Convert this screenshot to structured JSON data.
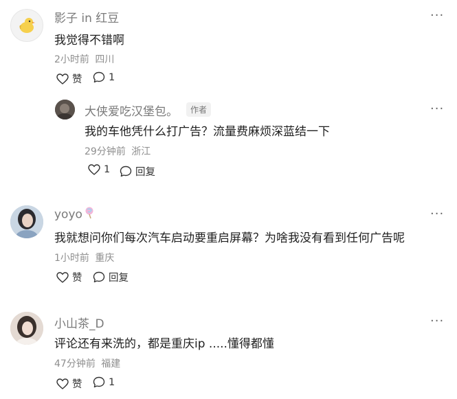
{
  "comments": [
    {
      "author": "影子 in 红豆",
      "text": "我觉得不错啊",
      "time": "2小时前",
      "location": "四川",
      "like_label": "赞",
      "reply_count": "1",
      "more": "···"
    },
    {
      "author": "大侠爱吃汉堡包。",
      "author_tag": "作者",
      "text": "我的车他凭什么打广告？流量费麻烦深蓝结一下",
      "time": "29分钟前",
      "location": "浙江",
      "like_count": "1",
      "reply_label": "回复",
      "more": "···"
    },
    {
      "author": "yoyo",
      "text": "我就想问你们每次汽车启动要重启屏幕？为啥我没有看到任何广告呢",
      "time": "1小时前",
      "location": "重庆",
      "like_label": "赞",
      "reply_label": "回复",
      "more": "···"
    },
    {
      "author": "小山茶_D",
      "text": "评论还有来洗的，都是重庆ip .....懂得都懂",
      "time": "47分钟前",
      "location": "福建",
      "like_label": "赞",
      "reply_count": "1",
      "more": "···"
    }
  ],
  "icons": {
    "like": "heart-outline-icon",
    "reply": "chat-bubble-icon",
    "more": "more-dots-icon",
    "lollipop": "lollipop-emoji-icon"
  },
  "colors": {
    "name": "#7a7a7a",
    "meta": "#8e8e8e",
    "text": "#1f1f1f"
  }
}
